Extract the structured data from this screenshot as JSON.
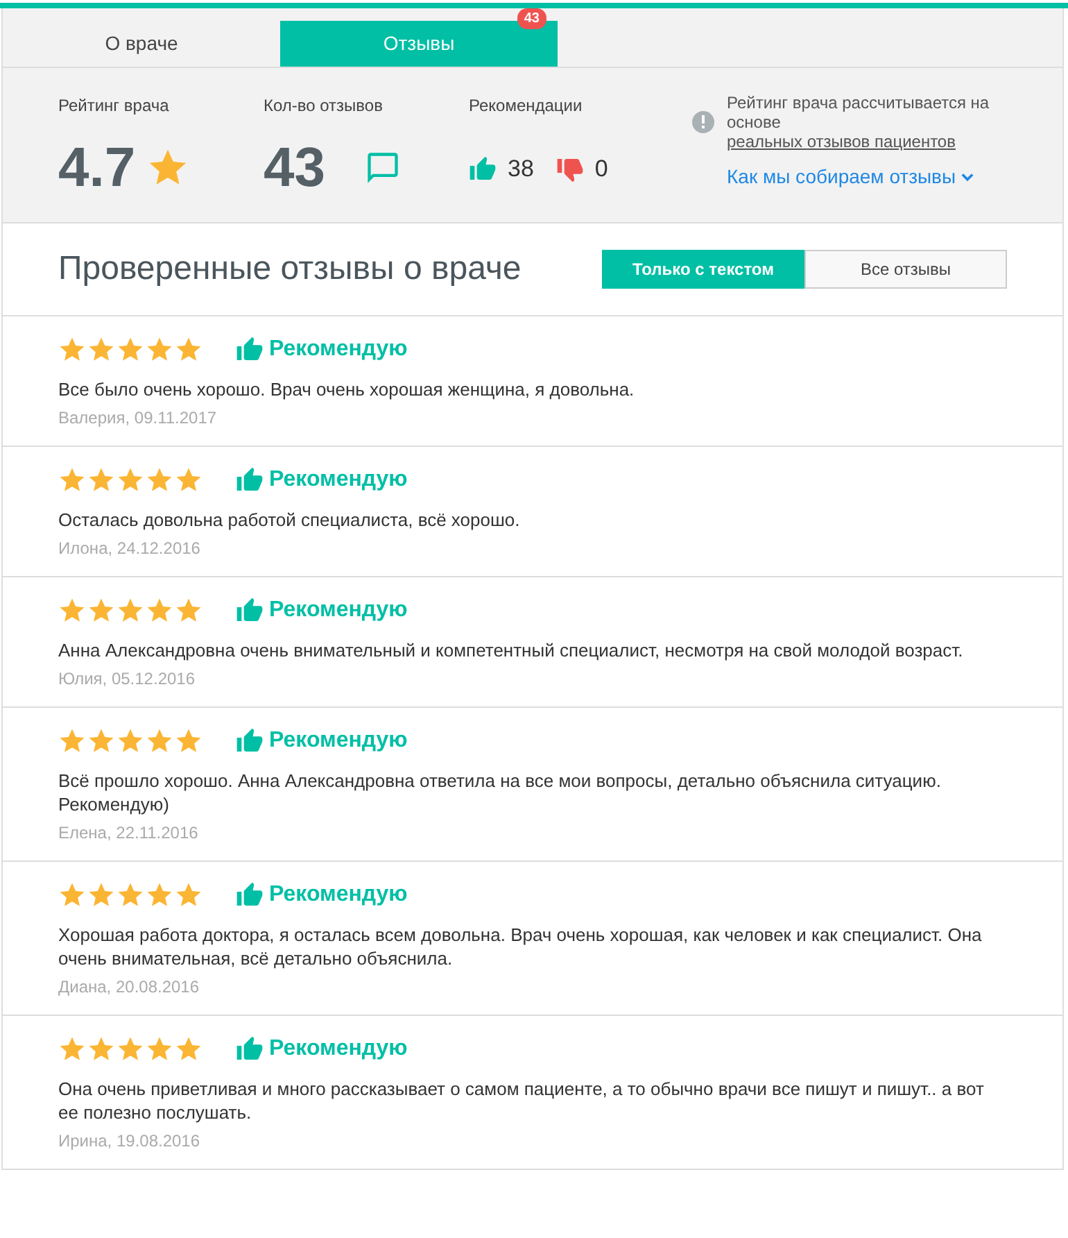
{
  "tabs": [
    {
      "label": "О враче",
      "selected": false
    },
    {
      "label": "Отзывы",
      "selected": true,
      "badge": "43"
    }
  ],
  "stats": {
    "rating": {
      "label": "Рейтинг врача",
      "value": "4.7"
    },
    "count": {
      "label": "Кол-во отзывов",
      "value": "43"
    },
    "recommendations": {
      "label": "Рекомендации",
      "likes": "38",
      "dislikes": "0"
    },
    "info": {
      "text": "Рейтинг врача рассчитывается на основе ",
      "link": "реальных отзывов пациентов",
      "more": "Как мы собираем отзывы"
    }
  },
  "reviews_header": {
    "title": "Проверенные отзывы о враче",
    "filters": [
      {
        "label": "Только с текстом",
        "selected": true
      },
      {
        "label": "Все отзывы",
        "selected": false
      }
    ]
  },
  "reviews": [
    {
      "stars": 5,
      "recommend": "Рекомендую",
      "text": "Все было очень хорошо. Врач очень хорошая женщина, я довольна.",
      "author": "Валерия, 09.11.2017"
    },
    {
      "stars": 5,
      "recommend": "Рекомендую",
      "text": "Осталась довольна работой специалиста, всё хорошо.",
      "author": "Илона, 24.12.2016"
    },
    {
      "stars": 5,
      "recommend": "Рекомендую",
      "text": "Анна Александровна очень внимательный и компетентный специалист, несмотря на свой молодой возраст.",
      "author": "Юлия, 05.12.2016"
    },
    {
      "stars": 5,
      "recommend": "Рекомендую",
      "text": "Всё прошло хорошо. Анна Александровна ответила на все мои вопросы, детально объяснила ситуацию. Рекомендую)",
      "author": "Елена, 22.11.2016"
    },
    {
      "stars": 5,
      "recommend": "Рекомендую",
      "text": "Хорошая работа доктора, я осталась всем довольна. Врач очень хорошая, как человек и как специалист. Она очень внимательная, всё детально объяснила.",
      "author": "Диана, 20.08.2016"
    },
    {
      "stars": 5,
      "recommend": "Рекомендую",
      "text": "Она очень приветливая и много рассказывает о самом пациенте, а то обычно врачи все пишут и пишут.. а вот ее полезно послушать.",
      "author": "Ирина, 19.08.2016"
    }
  ]
}
